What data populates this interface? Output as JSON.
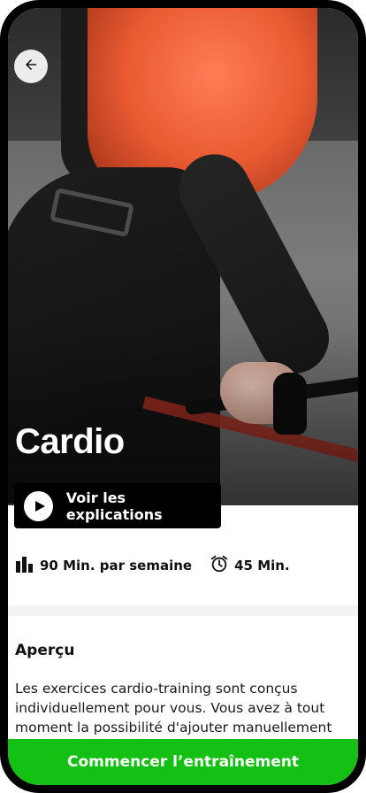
{
  "workout": {
    "title": "Cardio",
    "explain_label": "Voir les explications",
    "stats": {
      "weekly": "90 Min. par semaine",
      "duration": "45 Min."
    },
    "overview": {
      "heading": "Aperçu",
      "text": "Les exercices cardio-training sont conçus individuellement pour vous. Vous avez à tout moment la possibilité d'ajouter manuellement ici"
    },
    "cta_label": "Commencer l’entraînement"
  },
  "icons": {
    "back": "arrow-left-icon",
    "play": "play-icon",
    "stats": "bar-chart-icon",
    "duration": "alarm-clock-icon"
  },
  "colors": {
    "accent": "#14c014",
    "button_dark": "#000000",
    "text": "#111111"
  }
}
